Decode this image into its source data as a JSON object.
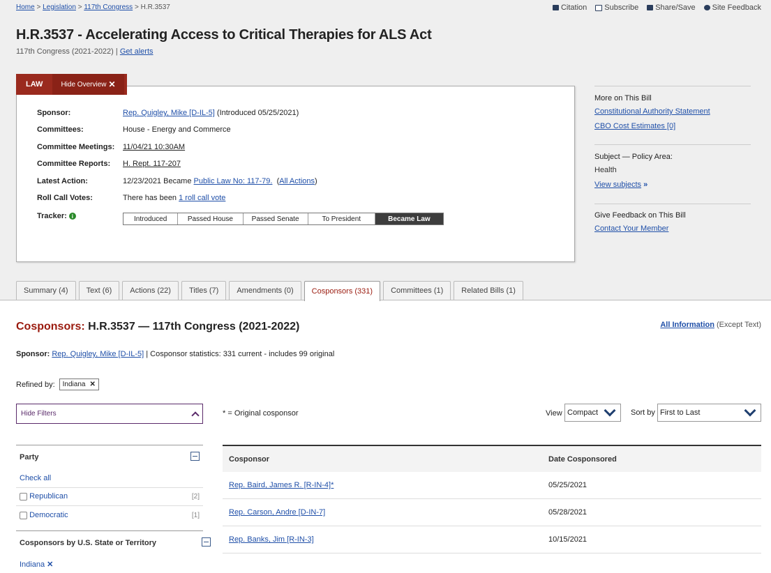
{
  "breadcrumb": {
    "home": "Home",
    "sep": ">",
    "legislation": "Legislation",
    "congress": "117th Congress",
    "current": "H.R.3537"
  },
  "tools": {
    "citation": "Citation",
    "subscribe": "Subscribe",
    "share": "Share/Save",
    "feedback": "Site Feedback"
  },
  "bill": {
    "title": "H.R.3537 - Accelerating Access to Critical Therapies for ALS Act",
    "congress": "117th Congress (2021-2022)",
    "alert_sep": "|",
    "get_alerts": "Get alerts"
  },
  "overview": {
    "status": "LAW",
    "hide": "Hide Overview",
    "hide_x": "✕",
    "sponsor_label": "Sponsor:",
    "sponsor": "Rep. Quigley, Mike [D-IL-5]",
    "sponsor_intro": "(Introduced 05/25/2021)",
    "committees_label": "Committees:",
    "committees": "House - Energy and Commerce",
    "meetings_label": "Committee Meetings:",
    "meetings": "11/04/21 10:30AM",
    "reports_label": "Committee Reports:",
    "reports": "H. Rept. 117-207",
    "latest_label": "Latest Action:",
    "latest_text": "12/23/2021 Became",
    "latest_link": "Public Law No: 117-79.",
    "latest_all_open": "(",
    "latest_all": "All Actions",
    "latest_all_close": ")",
    "rollcall_label": "Roll Call Votes:",
    "rollcall_text": "There has been",
    "rollcall_link": "1 roll call vote",
    "tracker_label": "Tracker:",
    "tracker_info": "i",
    "tracker_steps": [
      "Introduced",
      "Passed House",
      "Passed Senate",
      "To President",
      "Became Law"
    ]
  },
  "sidebar": {
    "more_heading": "More on This Bill",
    "constitutional": "Constitutional Authority Statement",
    "cbo": "CBO Cost Estimates [0]",
    "subject_heading": "Subject — Policy Area:",
    "subject": "Health",
    "view_subjects": "View subjects",
    "view_subjects_chev": "»",
    "feedback_heading": "Give Feedback on This Bill",
    "contact": "Contact Your Member"
  },
  "tabs": [
    {
      "label": "Summary (4)"
    },
    {
      "label": "Text (6)"
    },
    {
      "label": "Actions (22)"
    },
    {
      "label": "Titles (7)"
    },
    {
      "label": "Amendments (0)"
    },
    {
      "label": "Cosponsors (331)"
    },
    {
      "label": "Committees (1)"
    },
    {
      "label": "Related Bills (1)"
    }
  ],
  "cosponsors": {
    "heading_red": "Cosponsors:",
    "heading_rest": "H.R.3537 — 117th Congress (2021-2022)",
    "all_info": "All Information",
    "except_text": "(Except Text)",
    "sponsor_label": "Sponsor:",
    "sponsor": "Rep. Quigley, Mike [D-IL-5]",
    "stats": "| Cosponsor statistics: 331 current - includes 99 original",
    "refined_label": "Refined by:",
    "refined_tag": "Indiana",
    "refined_x": "✕",
    "hide_filters": "Hide Filters",
    "original_note": "* = Original cosponsor",
    "view_label": "View",
    "view_value": "Compact",
    "sort_label": "Sort by",
    "sort_value": "First to Last"
  },
  "filters": {
    "party_heading": "Party",
    "check_all": "Check all",
    "republican": "Republican",
    "republican_count": "[2]",
    "democratic": "Democratic",
    "democratic_count": "[1]",
    "state_heading": "Cosponsors by U.S. State or Territory",
    "state_selected": "Indiana",
    "state_x": "✕"
  },
  "table": {
    "col_cosponsor": "Cosponsor",
    "col_date": "Date Cosponsored",
    "rows": [
      {
        "name": "Rep. Baird, James R. [R-IN-4]*",
        "date": "05/25/2021"
      },
      {
        "name": "Rep. Carson, Andre [D-IN-7]",
        "date": "05/28/2021"
      },
      {
        "name": "Rep. Banks, Jim [R-IN-3]",
        "date": "10/15/2021"
      }
    ]
  }
}
